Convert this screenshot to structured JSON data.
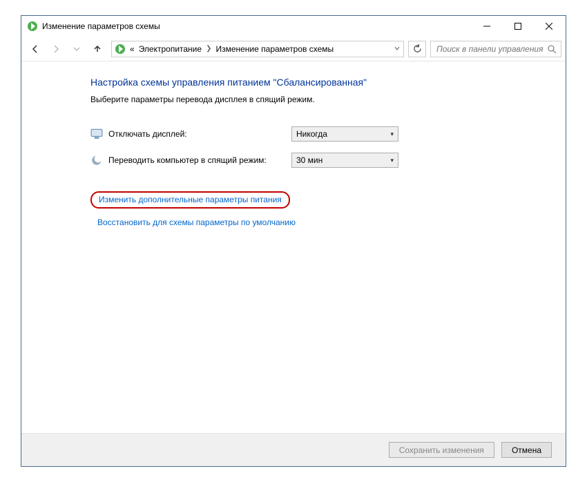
{
  "window": {
    "title": "Изменение параметров схемы"
  },
  "nav": {
    "breadcrumbs": {
      "prefix": "«",
      "item1": "Электропитание",
      "item2": "Изменение параметров схемы"
    },
    "search_placeholder": "Поиск в панели управления"
  },
  "content": {
    "heading": "Настройка схемы управления питанием \"Сбалансированная\"",
    "subtext": "Выберите параметры перевода дисплея в спящий режим.",
    "rows": {
      "display_off": {
        "label": "Отключать дисплей:",
        "value": "Никогда"
      },
      "sleep": {
        "label": "Переводить компьютер в спящий режим:",
        "value": "30 мин"
      }
    },
    "links": {
      "advanced": "Изменить дополнительные параметры питания",
      "restore": "Восстановить для схемы параметры по умолчанию"
    }
  },
  "footer": {
    "save": "Сохранить изменения",
    "cancel": "Отмена"
  }
}
